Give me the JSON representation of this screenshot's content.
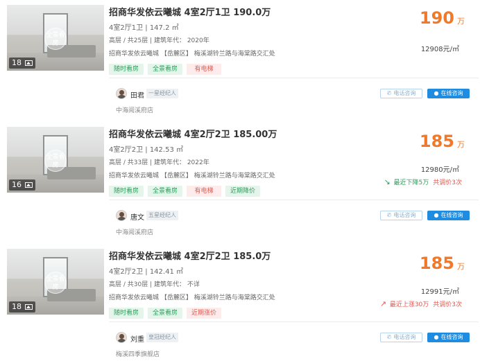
{
  "listings": [
    {
      "photo_count": "18",
      "vr_label": "全景看房",
      "title": "招商华发依云曦城 4室2厅1卫 190.0万",
      "specs": "4室2厅1卫 | 147.2 ㎡",
      "floor_info": "高层 / 共25层 | 建筑年代： 2020年",
      "address": "招商华发依云曦城 【岳麓区】 梅溪湖铃兰路与海棠路交汇处",
      "tags": [
        {
          "label": "随时看房",
          "color": "green"
        },
        {
          "label": "全景看房",
          "color": "green"
        },
        {
          "label": "有电梯",
          "color": "red"
        }
      ],
      "price": "190",
      "price_unit": "万",
      "unit_price": "12908元/㎡",
      "trend": null,
      "agent": {
        "name": "田君",
        "level": "一星经纪人",
        "store": "中海阅溪府店"
      },
      "phone_label": "电话咨询",
      "chat_label": "在线咨询"
    },
    {
      "photo_count": "16",
      "vr_label": "全景看房",
      "title": "招商华发依云曦城 4室2厅2卫 185.00万",
      "specs": "4室2厅2卫 | 142.53 ㎡",
      "floor_info": "高层 / 共33层 | 建筑年代： 2022年",
      "address": "招商华发依云曦城 【岳麓区】 梅溪湖铃兰路与海棠路交汇处",
      "tags": [
        {
          "label": "随时看房",
          "color": "green"
        },
        {
          "label": "全景看房",
          "color": "green"
        },
        {
          "label": "有电梯",
          "color": "red"
        },
        {
          "label": "近期降价",
          "color": "green"
        }
      ],
      "price": "185",
      "price_unit": "万",
      "unit_price": "12980元/㎡",
      "trend": {
        "direction": "down",
        "text": "最近下降5万",
        "adjust": "共调价3次"
      },
      "agent": {
        "name": "唐文",
        "level": "五星经纪人",
        "store": "中海阅溪府店"
      },
      "phone_label": "电话咨询",
      "chat_label": "在线咨询"
    },
    {
      "photo_count": "18",
      "vr_label": "全景看房",
      "title": "招商华发依云曦城 4室2厅2卫 185.0万",
      "specs": "4室2厅2卫 | 142.41 ㎡",
      "floor_info": "高层 / 共30层 | 建筑年代： 不详",
      "address": "招商华发依云曦城 【岳麓区】 梅溪湖铃兰路与海棠路交汇处",
      "tags": [
        {
          "label": "随时看房",
          "color": "green"
        },
        {
          "label": "全景看房",
          "color": "green"
        },
        {
          "label": "近期涨价",
          "color": "red"
        }
      ],
      "price": "185",
      "price_unit": "万",
      "unit_price": "12991元/㎡",
      "trend": {
        "direction": "up",
        "text": "最近上涨30万",
        "adjust": "共调价3次"
      },
      "agent": {
        "name": "刘重",
        "level": "皇冠经纪人",
        "store": "梅溪四季旗舰店"
      },
      "phone_label": "电话咨询",
      "chat_label": "在线咨询"
    }
  ],
  "colors": {
    "price": "#f07a29",
    "tag_green_text": "#2e9c5d",
    "tag_red_text": "#e4574e",
    "chat_button": "#1f8ce0"
  },
  "icons": {
    "photo": "image-icon",
    "phone": "phone-icon",
    "chat": "chat-bubble-icon",
    "trend_down": "trend-down-icon",
    "trend_up": "trend-up-icon"
  }
}
